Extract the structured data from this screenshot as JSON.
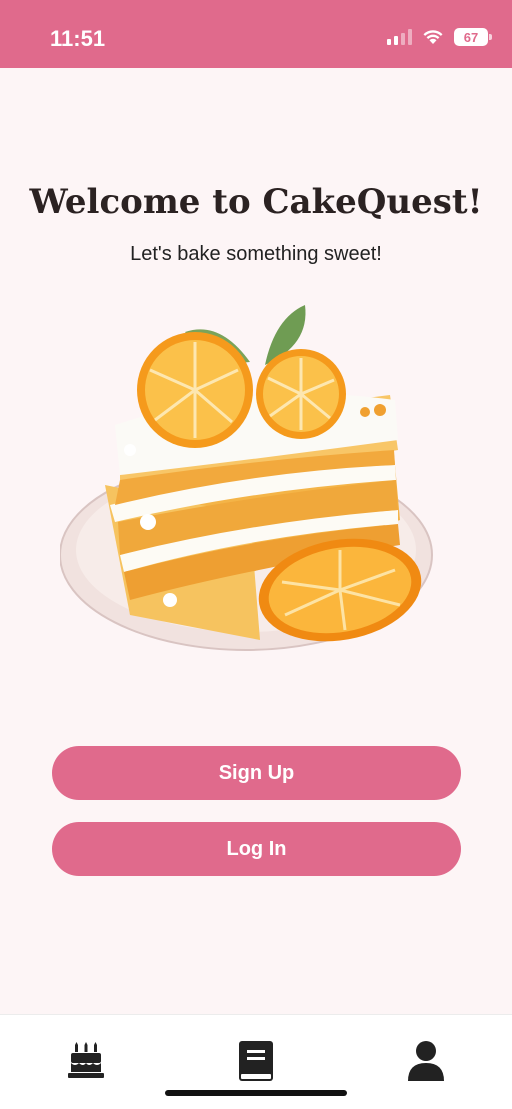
{
  "status_bar": {
    "time": "11:51",
    "battery": "67",
    "background": "#e06a8c"
  },
  "main": {
    "title": "Welcome to CakeQuest!",
    "subtitle": "Let's bake something sweet!",
    "illustration": "orange-cake-slice"
  },
  "actions": {
    "sign_up_label": "Sign Up",
    "log_in_label": "Log In",
    "accent": "#e06a8c"
  },
  "tab_bar": {
    "items": [
      {
        "icon": "birthday-cake-icon"
      },
      {
        "icon": "recipe-book-icon"
      },
      {
        "icon": "user-icon"
      }
    ]
  }
}
